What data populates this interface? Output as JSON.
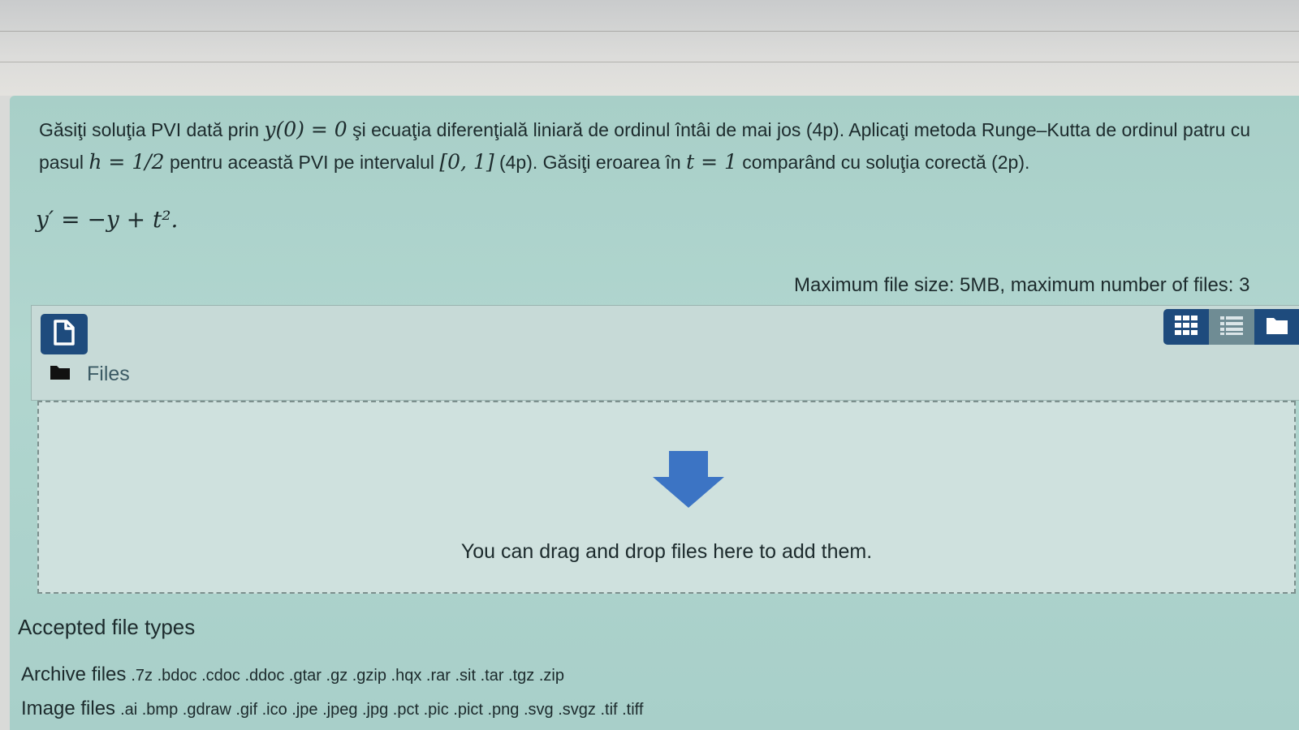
{
  "question": {
    "line1_a": "Găsiţi soluţia PVI dată prin ",
    "math_y0": "y(0) = 0",
    "line1_b": " şi ecuaţia diferenţială liniară de ordinul întâi de mai jos (4p). Aplicaţi metoda Runge–Kutta de ordinul patru cu pasul ",
    "math_h": "h = 1/2",
    "line1_c": " pentru această PVI pe intervalul ",
    "math_interval": "[0, 1]",
    "line1_d": " (4p). Găsiţi eroarea în ",
    "math_t": "t = 1",
    "line1_e": " comparând cu soluţia corectă (2p).",
    "equation": "y′ = −y + t².",
    "max_file_info": "Maximum file size: 5MB, maximum number of files: 3"
  },
  "filemanager": {
    "add_file_icon": "add-file-icon",
    "view_buttons": [
      "grid-view-icon",
      "list-view-icon",
      "tree-view-icon"
    ],
    "folder_label": "Files",
    "folder_icon": "folder-icon"
  },
  "dropzone": {
    "text": "You can drag and drop files here to add them.",
    "arrow_icon": "download-arrow-icon",
    "arrow_color": "#3c74c4"
  },
  "accepted": {
    "title": "Accepted file types",
    "rows": [
      {
        "label": "Archive files",
        "extensions": ".7z .bdoc .cdoc .ddoc .gtar .gz .gzip .hqx .rar .sit .tar .tgz .zip"
      },
      {
        "label": "Image files",
        "extensions": ".ai .bmp .gdraw .gif .ico .jpe .jpeg .jpg .pct .pic .pict .png .svg .svgz .tif .tiff"
      }
    ]
  },
  "colors": {
    "panel": "#b1d6cf",
    "primary_button": "#1e4b7d"
  }
}
